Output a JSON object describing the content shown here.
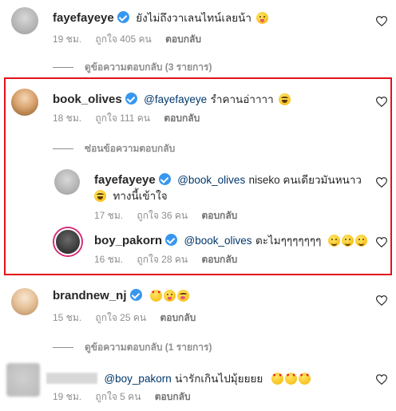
{
  "comments": [
    {
      "username": "fayefayeye",
      "verified": true,
      "text": "ยังไม่ถึงวาเลนไทน์เลยน้า",
      "emojis": [
        "squinting-tongue"
      ],
      "time": "19 ชม.",
      "likes": "ถูกใจ 405 คน",
      "reply": "ตอบกลับ",
      "replies_toggle": "ดูข้อความตอบกลับ (3 รายการ)"
    },
    {
      "username": "book_olives",
      "verified": true,
      "mention": "@fayefayeye",
      "text": "รำคานอ่าาาา",
      "emojis": [
        "tired-face"
      ],
      "time": "18 ชม.",
      "likes": "ถูกใจ 111 คน",
      "reply": "ตอบกลับ",
      "replies_toggle": "ซ่อนข้อความตอบกลับ",
      "replies": [
        {
          "username": "fayefayeye",
          "verified": true,
          "mention": "@book_olives",
          "text": "niseko คนเดียวมันหนาว",
          "text2": "ทางนี้เข้าใจ",
          "emojis": [
            "rofl"
          ],
          "time": "17 ชม.",
          "likes": "ถูกใจ 36 คน",
          "reply": "ตอบกลับ"
        },
        {
          "username": "boy_pakorn",
          "verified": true,
          "mention": "@book_olives",
          "text": "ตะไมๆๆๆๆๆๆๆ",
          "emojis": [
            "smile",
            "smile",
            "smile"
          ],
          "time": "16 ชม.",
          "likes": "ถูกใจ 28 คน",
          "reply": "ตอบกลับ"
        }
      ]
    },
    {
      "username": "brandnew_nj",
      "verified": true,
      "emojis": [
        "heart-eyes",
        "squinting-tongue",
        "zany"
      ],
      "time": "15 ชม.",
      "likes": "ถูกใจ 25 คน",
      "reply": "ตอบกลับ",
      "replies_toggle": "ดูข้อความตอบกลับ (1 รายการ)"
    },
    {
      "username": "",
      "mention": "@boy_pakorn",
      "text": "น่ารักเกินไปมุ้ยยยย",
      "emojis": [
        "heart-eyes",
        "heart-eyes",
        "heart-eyes"
      ],
      "time": "19 ชม.",
      "likes": "ถูกใจ 5 คน",
      "reply": "ตอบกลับ"
    }
  ],
  "colors": {
    "highlight_border": "#e3101a",
    "verified": "#3797f0",
    "mention": "#00376b",
    "meta_text": "#8e8e8e"
  }
}
